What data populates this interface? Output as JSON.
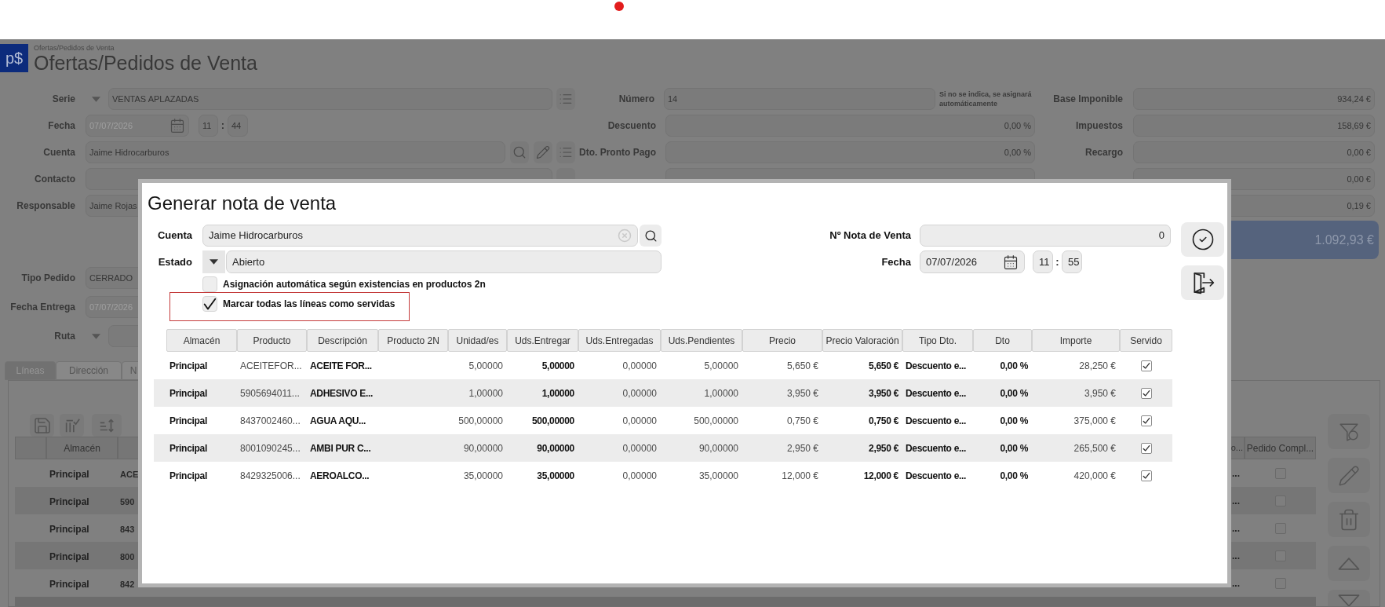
{
  "header": {
    "logo": "p$",
    "breadcrumb": "Ofertas/Pedidos de Venta",
    "title": "Ofertas/Pedidos de Venta"
  },
  "form": {
    "left": [
      {
        "kind": "select_list",
        "label": "Serie",
        "value": "VENTAS APLAZADAS"
      },
      {
        "kind": "datetime",
        "label": "Fecha",
        "value": "07/07/2026",
        "hour": "11",
        "separator": ":",
        "minute": "44"
      },
      {
        "kind": "account",
        "label": "Cuenta",
        "value": "Jaime Hidrocarburos"
      },
      {
        "kind": "search",
        "label": "Contacto"
      },
      {
        "kind": "text",
        "label": "Responsable",
        "value": "Jaime Rojas"
      }
    ],
    "left_lower": [
      {
        "kind": "text",
        "label": "Tipo Pedido",
        "value": "CERRADO"
      },
      {
        "kind": "date",
        "label": "Fecha Entrega",
        "value": "07/07/2026"
      },
      {
        "kind": "select",
        "label": "Ruta"
      }
    ],
    "middle": [
      {
        "kind": "number",
        "label": "Número",
        "value": "14",
        "note": "Si no se indica, se asignará automáticamente"
      },
      {
        "kind": "amount",
        "label": "Descuento",
        "value": "0,00 %"
      },
      {
        "kind": "amount",
        "label": "Dto. Pronto Pago",
        "value": "0,00 %"
      },
      {
        "kind": "amount"
      }
    ],
    "right": [
      {
        "label": "Base Imponible",
        "value": "934,24 €"
      },
      {
        "label": "Impuestos",
        "value": "158,69 €"
      },
      {
        "label": "Recargo",
        "value": "0,00 €"
      },
      {
        "value": "0,00 €"
      },
      {
        "value": "0,19 €"
      }
    ],
    "total": "1.092,93 €"
  },
  "tabs": [
    {
      "label": "Líneas",
      "selected": true
    },
    {
      "label": "Dirección",
      "selected": false
    },
    {
      "label": "N",
      "selected": false
    }
  ],
  "lines": {
    "header": {
      "almacen": "Almacén",
      "column_3": "o...",
      "pedido_compl": "Pedido Compl..."
    },
    "rows": [
      {
        "almacen": "Principal",
        "column_2": "ACE",
        "column_3": "...",
        "checked": false
      },
      {
        "almacen": "Principal",
        "column_2": "590",
        "column_3": "...",
        "checked": false
      },
      {
        "almacen": "Principal",
        "column_2": "843",
        "column_3": "...",
        "checked": false
      },
      {
        "almacen": "Principal",
        "column_2": "800",
        "column_3": "...",
        "checked": false
      },
      {
        "almacen": "Principal",
        "column_2": "842",
        "column_3": "...",
        "checked": false
      }
    ]
  },
  "dialog": {
    "title": "Generar nota de venta",
    "account": {
      "label": "Cuenta",
      "value": "Jaime Hidrocarburos"
    },
    "status": {
      "label": "Estado",
      "value": "Abierto"
    },
    "options": [
      {
        "label": "Asignación automática según existencias en productos 2n",
        "checked": false,
        "highlighted": false
      },
      {
        "label": "Marcar todas las líneas como servidas",
        "checked": true,
        "highlighted": true
      }
    ],
    "note_number": {
      "label": "Nº Nota de Venta",
      "value": "0"
    },
    "date": {
      "label": "Fecha",
      "value": "07/07/2026",
      "hour": "11",
      "separator": ":",
      "minute": "55"
    },
    "table": {
      "columns": [
        "Almacén",
        "Producto",
        "Descripción",
        "Producto 2N",
        "Unidad/es",
        "Uds.Entregar",
        "Uds.Entregadas",
        "Uds.Pendientes",
        "Precio",
        "Precio Valoración",
        "Tipo Dto.",
        "Dto",
        "Importe",
        "Servido"
      ],
      "rows": [
        {
          "almacen": "Principal",
          "producto": "ACEITEFOR...",
          "descripcion": "ACEITE FOR...",
          "unidades": "5,00000",
          "uds_entregar": "5,00000",
          "uds_entregadas": "0,00000",
          "uds_pendientes": "5,00000",
          "precio": "5,650 €",
          "precio_valoracion": "5,650 €",
          "tipo_dto": "Descuento e...",
          "dto": "0,00 %",
          "importe": "28,250 €",
          "servido": true
        },
        {
          "almacen": "Principal",
          "producto": "5905694011...",
          "descripcion": "ADHESIVO E...",
          "unidades": "1,00000",
          "uds_entregar": "1,00000",
          "uds_entregadas": "0,00000",
          "uds_pendientes": "1,00000",
          "precio": "3,950 €",
          "precio_valoracion": "3,950 €",
          "tipo_dto": "Descuento e...",
          "dto": "0,00 %",
          "importe": "3,950 €",
          "servido": true
        },
        {
          "almacen": "Principal",
          "producto": "8437002460...",
          "descripcion": "AGUA AQU...",
          "unidades": "500,00000",
          "uds_entregar": "500,00000",
          "uds_entregadas": "0,00000",
          "uds_pendientes": "500,00000",
          "precio": "0,750 €",
          "precio_valoracion": "0,750 €",
          "tipo_dto": "Descuento e...",
          "dto": "0,00 %",
          "importe": "375,000 €",
          "servido": true
        },
        {
          "almacen": "Principal",
          "producto": "8001090245...",
          "descripcion": "AMBI PUR C...",
          "unidades": "90,00000",
          "uds_entregar": "90,00000",
          "uds_entregadas": "0,00000",
          "uds_pendientes": "90,00000",
          "precio": "2,950 €",
          "precio_valoracion": "2,950 €",
          "tipo_dto": "Descuento e...",
          "dto": "0,00 %",
          "importe": "265,500 €",
          "servido": true
        },
        {
          "almacen": "Principal",
          "producto": "8429325006...",
          "descripcion": "AEROALCO...",
          "unidades": "35,00000",
          "uds_entregar": "35,00000",
          "uds_entregadas": "0,00000",
          "uds_pendientes": "35,00000",
          "precio": "12,000 €",
          "precio_valoracion": "12,000 €",
          "tipo_dto": "Descuento e...",
          "dto": "0,00 %",
          "importe": "420,000 €",
          "servido": true
        }
      ]
    }
  }
}
